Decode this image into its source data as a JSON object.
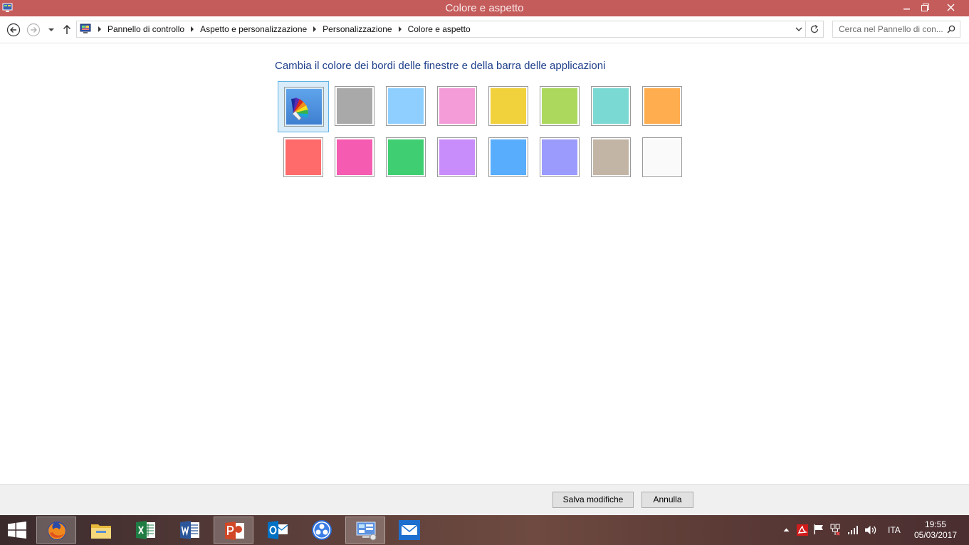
{
  "window": {
    "title": "Colore e aspetto"
  },
  "address": {
    "breadcrumbs": [
      "Pannello di controllo",
      "Aspetto e personalizzazione",
      "Personalizzazione",
      "Colore e aspetto"
    ],
    "search_placeholder": "Cerca nel Pannello di con..."
  },
  "content": {
    "heading": "Cambia il colore dei bordi delle finestre e della barra delle applicazioni",
    "selected_index": 0,
    "swatches_row1": [
      {
        "name": "automatic",
        "color": "#4a90d9",
        "icon": "color-fan-icon"
      },
      {
        "name": "gray",
        "color": "#a9a9a9"
      },
      {
        "name": "light-blue",
        "color": "#8fcfff"
      },
      {
        "name": "pink",
        "color": "#f49cd8"
      },
      {
        "name": "yellow",
        "color": "#f1d13c"
      },
      {
        "name": "lime",
        "color": "#acd95d"
      },
      {
        "name": "teal",
        "color": "#7bd9d3"
      },
      {
        "name": "orange",
        "color": "#ffad4e"
      }
    ],
    "swatches_row2": [
      {
        "name": "red",
        "color": "#ff6b6b"
      },
      {
        "name": "magenta",
        "color": "#f55cb1"
      },
      {
        "name": "green",
        "color": "#3fcf72"
      },
      {
        "name": "violet",
        "color": "#c98cfb"
      },
      {
        "name": "blue",
        "color": "#58adfd"
      },
      {
        "name": "periwinkle",
        "color": "#9b9bfe"
      },
      {
        "name": "taupe",
        "color": "#c3b5a5"
      },
      {
        "name": "white",
        "color": "#fafafa"
      }
    ]
  },
  "footer": {
    "save_label": "Salva modifiche",
    "cancel_label": "Annulla"
  },
  "taskbar": {
    "apps": [
      "firefox-icon",
      "file-explorer-icon",
      "excel-icon",
      "word-icon",
      "powerpoint-icon",
      "outlook-icon",
      "app-circles-icon",
      "control-panel-icon",
      "mail-icon"
    ],
    "language": "ITA",
    "time": "19:55",
    "date": "05/03/2017"
  },
  "colors": {
    "titlebar": "#c45c5c",
    "heading": "#1e3f8a",
    "selection_border": "#5fb1e6",
    "selection_fill": "#d8ecf9"
  }
}
